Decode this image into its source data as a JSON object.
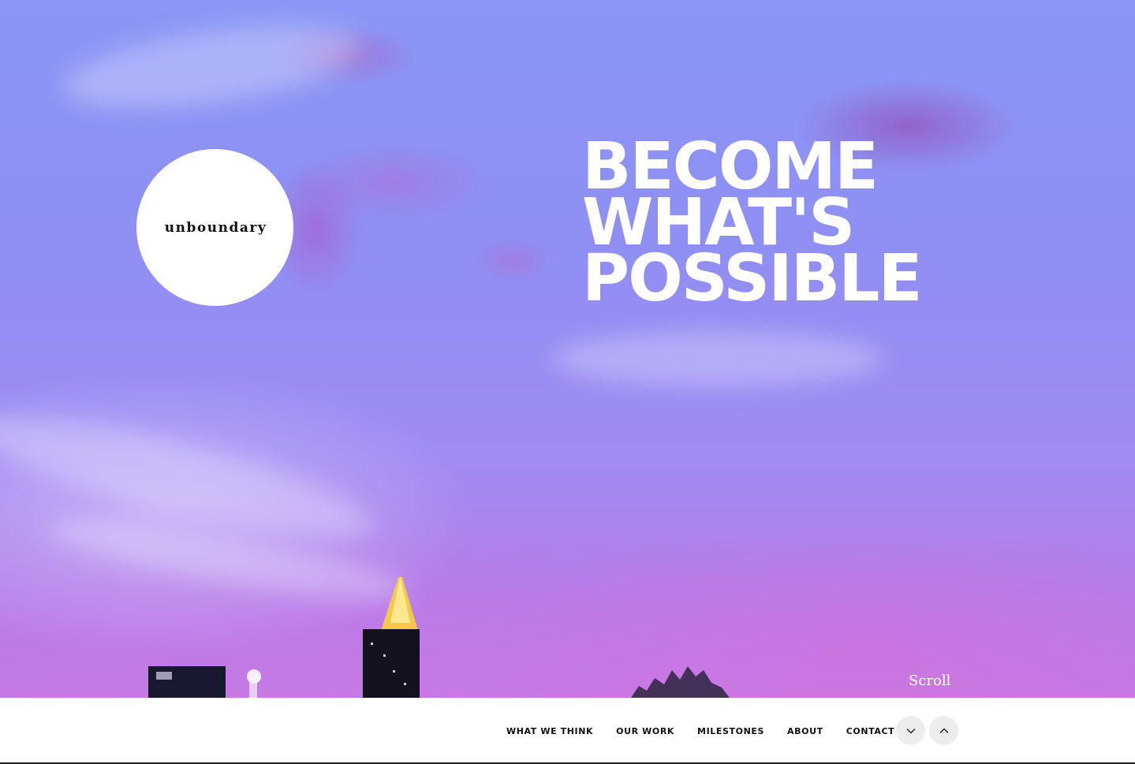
{
  "logo": {
    "text": "unboundary"
  },
  "hero": {
    "headline": [
      "BECOME",
      "WHAT'S",
      "POSSIBLE"
    ],
    "scroll_label": "Scroll"
  },
  "nav": {
    "items": [
      {
        "label": "WHAT WE THINK"
      },
      {
        "label": "OUR WORK"
      },
      {
        "label": "MILESTONES"
      },
      {
        "label": "ABOUT"
      },
      {
        "label": "CONTACT"
      }
    ],
    "next_icon": "chevron-down-icon",
    "prev_icon": "chevron-up-icon"
  },
  "colors": {
    "sky_top": "#8a97f4",
    "sky_bottom": "#c47ae2",
    "headline": "#ffffff",
    "nav_bg": "#ffffff",
    "nav_text": "#111111",
    "arrow_button_bg": "#ededed"
  }
}
